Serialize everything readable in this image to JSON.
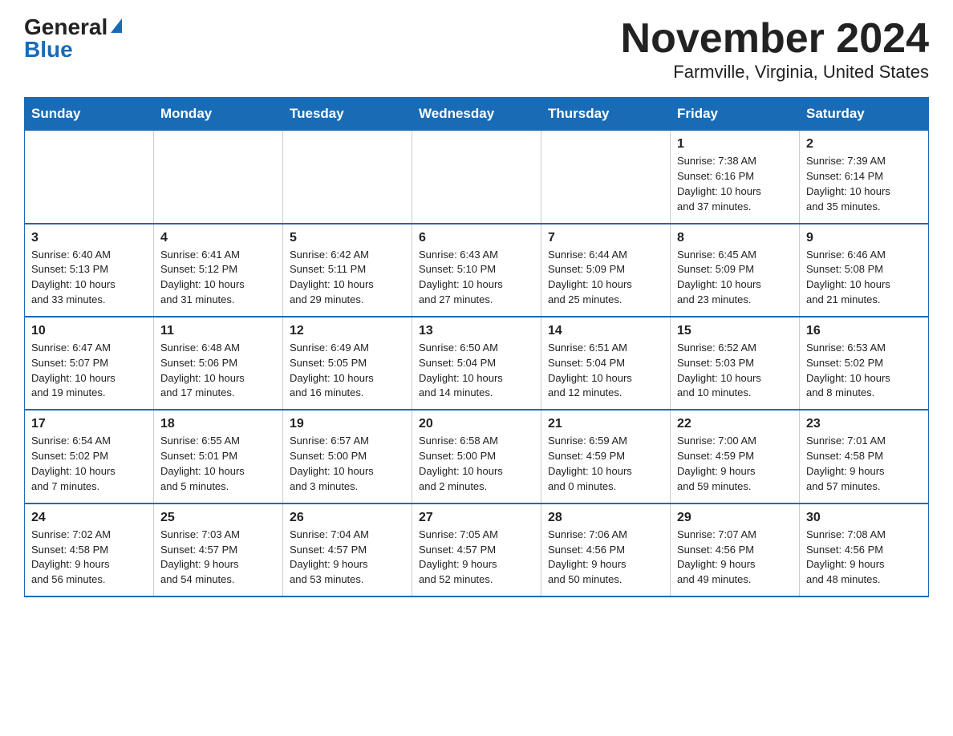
{
  "logo": {
    "general": "General",
    "blue": "Blue"
  },
  "title": "November 2024",
  "subtitle": "Farmville, Virginia, United States",
  "days_of_week": [
    "Sunday",
    "Monday",
    "Tuesday",
    "Wednesday",
    "Thursday",
    "Friday",
    "Saturday"
  ],
  "weeks": [
    [
      {
        "day": "",
        "info": ""
      },
      {
        "day": "",
        "info": ""
      },
      {
        "day": "",
        "info": ""
      },
      {
        "day": "",
        "info": ""
      },
      {
        "day": "",
        "info": ""
      },
      {
        "day": "1",
        "info": "Sunrise: 7:38 AM\nSunset: 6:16 PM\nDaylight: 10 hours\nand 37 minutes."
      },
      {
        "day": "2",
        "info": "Sunrise: 7:39 AM\nSunset: 6:14 PM\nDaylight: 10 hours\nand 35 minutes."
      }
    ],
    [
      {
        "day": "3",
        "info": "Sunrise: 6:40 AM\nSunset: 5:13 PM\nDaylight: 10 hours\nand 33 minutes."
      },
      {
        "day": "4",
        "info": "Sunrise: 6:41 AM\nSunset: 5:12 PM\nDaylight: 10 hours\nand 31 minutes."
      },
      {
        "day": "5",
        "info": "Sunrise: 6:42 AM\nSunset: 5:11 PM\nDaylight: 10 hours\nand 29 minutes."
      },
      {
        "day": "6",
        "info": "Sunrise: 6:43 AM\nSunset: 5:10 PM\nDaylight: 10 hours\nand 27 minutes."
      },
      {
        "day": "7",
        "info": "Sunrise: 6:44 AM\nSunset: 5:09 PM\nDaylight: 10 hours\nand 25 minutes."
      },
      {
        "day": "8",
        "info": "Sunrise: 6:45 AM\nSunset: 5:09 PM\nDaylight: 10 hours\nand 23 minutes."
      },
      {
        "day": "9",
        "info": "Sunrise: 6:46 AM\nSunset: 5:08 PM\nDaylight: 10 hours\nand 21 minutes."
      }
    ],
    [
      {
        "day": "10",
        "info": "Sunrise: 6:47 AM\nSunset: 5:07 PM\nDaylight: 10 hours\nand 19 minutes."
      },
      {
        "day": "11",
        "info": "Sunrise: 6:48 AM\nSunset: 5:06 PM\nDaylight: 10 hours\nand 17 minutes."
      },
      {
        "day": "12",
        "info": "Sunrise: 6:49 AM\nSunset: 5:05 PM\nDaylight: 10 hours\nand 16 minutes."
      },
      {
        "day": "13",
        "info": "Sunrise: 6:50 AM\nSunset: 5:04 PM\nDaylight: 10 hours\nand 14 minutes."
      },
      {
        "day": "14",
        "info": "Sunrise: 6:51 AM\nSunset: 5:04 PM\nDaylight: 10 hours\nand 12 minutes."
      },
      {
        "day": "15",
        "info": "Sunrise: 6:52 AM\nSunset: 5:03 PM\nDaylight: 10 hours\nand 10 minutes."
      },
      {
        "day": "16",
        "info": "Sunrise: 6:53 AM\nSunset: 5:02 PM\nDaylight: 10 hours\nand 8 minutes."
      }
    ],
    [
      {
        "day": "17",
        "info": "Sunrise: 6:54 AM\nSunset: 5:02 PM\nDaylight: 10 hours\nand 7 minutes."
      },
      {
        "day": "18",
        "info": "Sunrise: 6:55 AM\nSunset: 5:01 PM\nDaylight: 10 hours\nand 5 minutes."
      },
      {
        "day": "19",
        "info": "Sunrise: 6:57 AM\nSunset: 5:00 PM\nDaylight: 10 hours\nand 3 minutes."
      },
      {
        "day": "20",
        "info": "Sunrise: 6:58 AM\nSunset: 5:00 PM\nDaylight: 10 hours\nand 2 minutes."
      },
      {
        "day": "21",
        "info": "Sunrise: 6:59 AM\nSunset: 4:59 PM\nDaylight: 10 hours\nand 0 minutes."
      },
      {
        "day": "22",
        "info": "Sunrise: 7:00 AM\nSunset: 4:59 PM\nDaylight: 9 hours\nand 59 minutes."
      },
      {
        "day": "23",
        "info": "Sunrise: 7:01 AM\nSunset: 4:58 PM\nDaylight: 9 hours\nand 57 minutes."
      }
    ],
    [
      {
        "day": "24",
        "info": "Sunrise: 7:02 AM\nSunset: 4:58 PM\nDaylight: 9 hours\nand 56 minutes."
      },
      {
        "day": "25",
        "info": "Sunrise: 7:03 AM\nSunset: 4:57 PM\nDaylight: 9 hours\nand 54 minutes."
      },
      {
        "day": "26",
        "info": "Sunrise: 7:04 AM\nSunset: 4:57 PM\nDaylight: 9 hours\nand 53 minutes."
      },
      {
        "day": "27",
        "info": "Sunrise: 7:05 AM\nSunset: 4:57 PM\nDaylight: 9 hours\nand 52 minutes."
      },
      {
        "day": "28",
        "info": "Sunrise: 7:06 AM\nSunset: 4:56 PM\nDaylight: 9 hours\nand 50 minutes."
      },
      {
        "day": "29",
        "info": "Sunrise: 7:07 AM\nSunset: 4:56 PM\nDaylight: 9 hours\nand 49 minutes."
      },
      {
        "day": "30",
        "info": "Sunrise: 7:08 AM\nSunset: 4:56 PM\nDaylight: 9 hours\nand 48 minutes."
      }
    ]
  ]
}
